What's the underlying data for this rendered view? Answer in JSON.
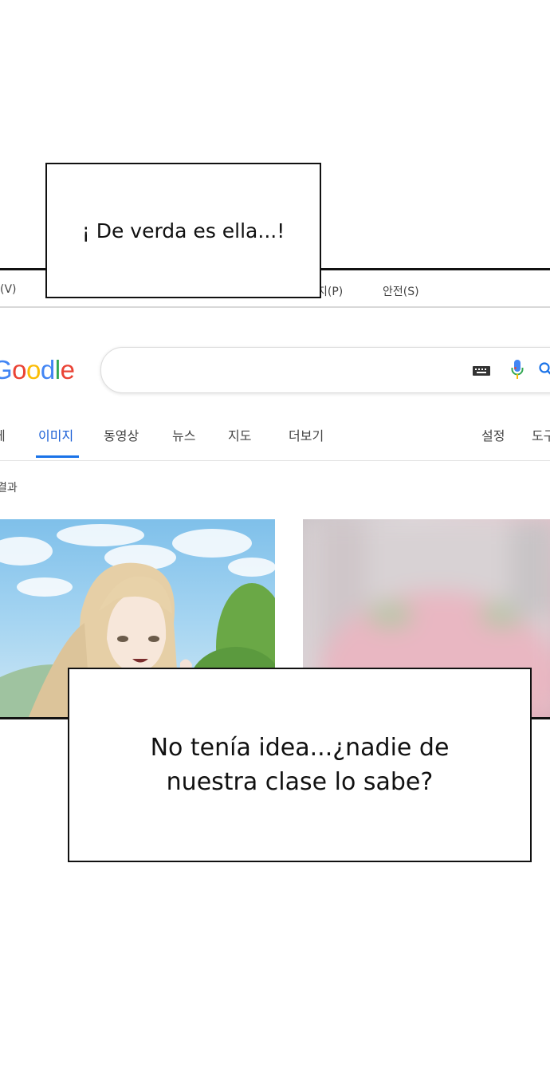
{
  "menubar": {
    "items": [
      "(V)",
      "지(P)",
      "안전(S)"
    ]
  },
  "logo": {
    "text": "Goodle",
    "colors": [
      "#4285F4",
      "#EA4335",
      "#FBBC05",
      "#4285F4",
      "#34A853",
      "#EA4335"
    ]
  },
  "search": {
    "value": "",
    "icons": [
      "keyboard-icon",
      "mic-icon",
      "search-icon"
    ]
  },
  "tabs": [
    {
      "label": "체"
    },
    {
      "label": "이미지",
      "active": true
    },
    {
      "label": "동영상"
    },
    {
      "label": "뉴스"
    },
    {
      "label": "지도"
    },
    {
      "label": "더보기"
    },
    {
      "label": "설정"
    },
    {
      "label": "도구"
    }
  ],
  "results": {
    "label": "결과"
  },
  "bubbles": {
    "top": "¡ De verda es ella...!",
    "bottom_line1": "No tenía idea...¿nadie de",
    "bottom_line2": "nuestra clase lo sabe?"
  },
  "colors": {
    "accent_blue": "#1a73e8",
    "panel_border": "#111111"
  }
}
